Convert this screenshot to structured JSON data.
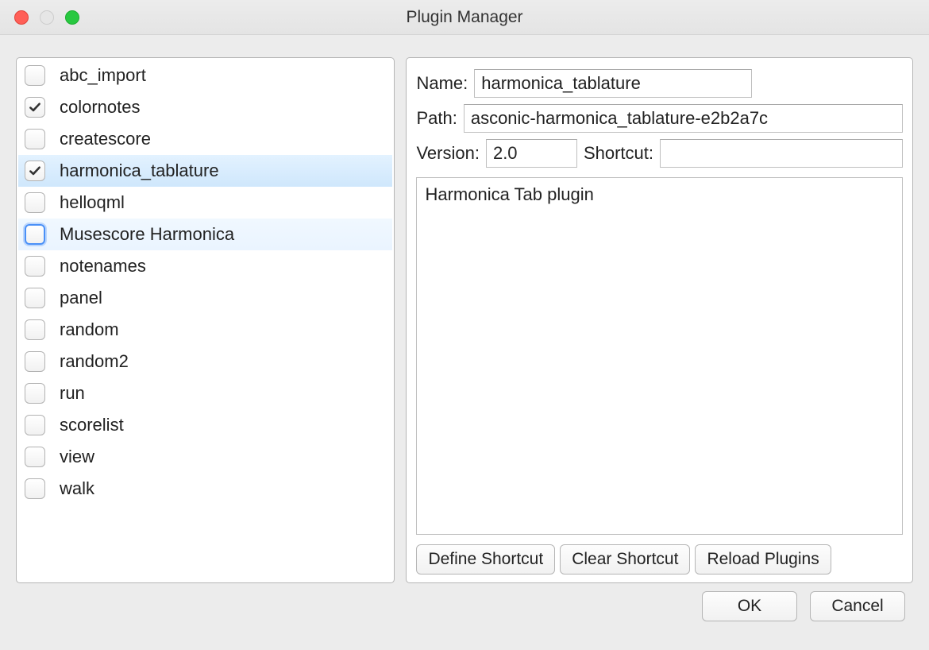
{
  "window": {
    "title": "Plugin Manager"
  },
  "plugins": [
    {
      "label": "abc_import",
      "checked": false,
      "selected": false,
      "focused": false
    },
    {
      "label": "colornotes",
      "checked": true,
      "selected": false,
      "focused": false
    },
    {
      "label": "createscore",
      "checked": false,
      "selected": false,
      "focused": false
    },
    {
      "label": "harmonica_tablature",
      "checked": true,
      "selected": true,
      "focused": false
    },
    {
      "label": "helloqml",
      "checked": false,
      "selected": false,
      "focused": false
    },
    {
      "label": "Musescore Harmonica",
      "checked": false,
      "selected": false,
      "focused": true,
      "highlight": true
    },
    {
      "label": "notenames",
      "checked": false,
      "selected": false,
      "focused": false
    },
    {
      "label": "panel",
      "checked": false,
      "selected": false,
      "focused": false
    },
    {
      "label": "random",
      "checked": false,
      "selected": false,
      "focused": false
    },
    {
      "label": "random2",
      "checked": false,
      "selected": false,
      "focused": false
    },
    {
      "label": "run",
      "checked": false,
      "selected": false,
      "focused": false
    },
    {
      "label": "scorelist",
      "checked": false,
      "selected": false,
      "focused": false
    },
    {
      "label": "view",
      "checked": false,
      "selected": false,
      "focused": false
    },
    {
      "label": "walk",
      "checked": false,
      "selected": false,
      "focused": false
    }
  ],
  "detail": {
    "name_label": "Name:",
    "name_value": "harmonica_tablature",
    "path_label": "Path:",
    "path_value": "asconic-harmonica_tablature-e2b2a7c",
    "version_label": "Version:",
    "version_value": "2.0",
    "shortcut_label": "Shortcut:",
    "shortcut_value": "",
    "description": "Harmonica Tab plugin"
  },
  "buttons": {
    "define_shortcut": "Define Shortcut",
    "clear_shortcut": "Clear Shortcut",
    "reload_plugins": "Reload Plugins",
    "ok": "OK",
    "cancel": "Cancel"
  }
}
